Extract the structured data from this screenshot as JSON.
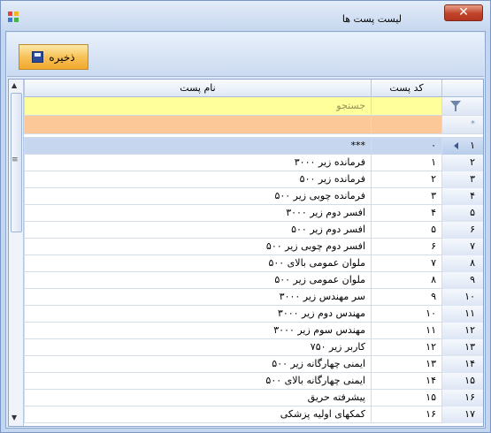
{
  "window": {
    "title": "لیست پست ها",
    "close_glyph": "✕"
  },
  "toolbar": {
    "save_label": "ذخیره"
  },
  "grid": {
    "columns": {
      "name": "نام پست",
      "code": "کد پست"
    },
    "filter_placeholder": "جستجو",
    "new_row_marker": "*",
    "rows": [
      {
        "index": "۱",
        "code": "۰",
        "name": "***"
      },
      {
        "index": "۲",
        "code": "۱",
        "name": "فرمانده زیر ۳۰۰۰"
      },
      {
        "index": "۳",
        "code": "۲",
        "name": "فرمانده زیر ۵۰۰"
      },
      {
        "index": "۴",
        "code": "۳",
        "name": "فرمانده چوبی زیر ۵۰۰"
      },
      {
        "index": "۵",
        "code": "۴",
        "name": "افسر دوم زیر ۳۰۰۰"
      },
      {
        "index": "۶",
        "code": "۵",
        "name": "افسر دوم زیر ۵۰۰"
      },
      {
        "index": "۷",
        "code": "۶",
        "name": "افسر دوم چوبی زیر ۵۰۰"
      },
      {
        "index": "۸",
        "code": "۷",
        "name": "ملوان عمومی بالای ۵۰۰"
      },
      {
        "index": "۹",
        "code": "۸",
        "name": "ملوان عمومی زیر ۵۰۰"
      },
      {
        "index": "۱۰",
        "code": "۹",
        "name": "سر مهندس زیر ۳۰۰۰"
      },
      {
        "index": "۱۱",
        "code": "۱۰",
        "name": "مهندس دوم زیر ۳۰۰۰"
      },
      {
        "index": "۱۲",
        "code": "۱۱",
        "name": "مهندس سوم زیر ۳۰۰۰"
      },
      {
        "index": "۱۳",
        "code": "۱۲",
        "name": "کاربر زیر ۷۵۰"
      },
      {
        "index": "۱۴",
        "code": "۱۳",
        "name": "ایمنی چهارگانه زیر ۵۰۰"
      },
      {
        "index": "۱۵",
        "code": "۱۴",
        "name": "ایمنی چهارگانه بالای ۵۰۰"
      },
      {
        "index": "۱۶",
        "code": "۱۵",
        "name": "پیشرفته حریق"
      },
      {
        "index": "۱۷",
        "code": "۱۶",
        "name": "کمکهای اولیه پزشکی"
      }
    ]
  }
}
